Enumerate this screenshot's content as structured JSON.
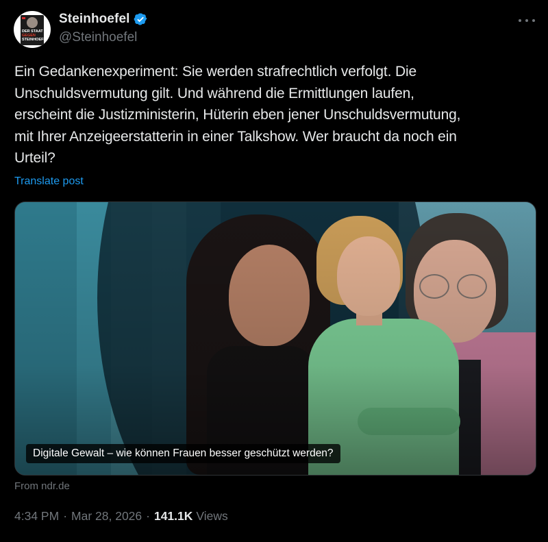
{
  "author": {
    "display_name": "Steinhoefel",
    "handle": "@Steinhoefel",
    "verified": true,
    "avatar_book_title": [
      "DER STAAT",
      "GEGEN",
      "STEINHOEFEL"
    ]
  },
  "tweet": {
    "text": "Ein Gedankenexperiment: Sie werden strafrechtlich verfolgt. Die\nUnschuldsvermutung gilt. Und während die Ermittlungen laufen,\nerscheint die Justizministerin, Hüterin eben jener Unschuldsvermutung,\nmit Ihrer Anzeigeerstatterin in einer Talkshow. Wer braucht da noch ein\nUrteil?",
    "translate_label": "Translate post"
  },
  "media": {
    "caption": "Digitale Gewalt – wie können Frauen besser geschützt werden?",
    "source": "From ndr.de"
  },
  "meta": {
    "time": "4:34 PM",
    "date": "Mar 28, 2026",
    "separator": "·",
    "views_count": "141.1K",
    "views_label": "Views"
  },
  "colors": {
    "background": "#000000",
    "text_primary": "#e7e9ea",
    "text_secondary": "#71767b",
    "link": "#1d9bf0",
    "verified_badge": "#1d9bf0"
  },
  "icons": {
    "verified": "verified-badge-icon",
    "more": "more-horizontal-icon"
  }
}
